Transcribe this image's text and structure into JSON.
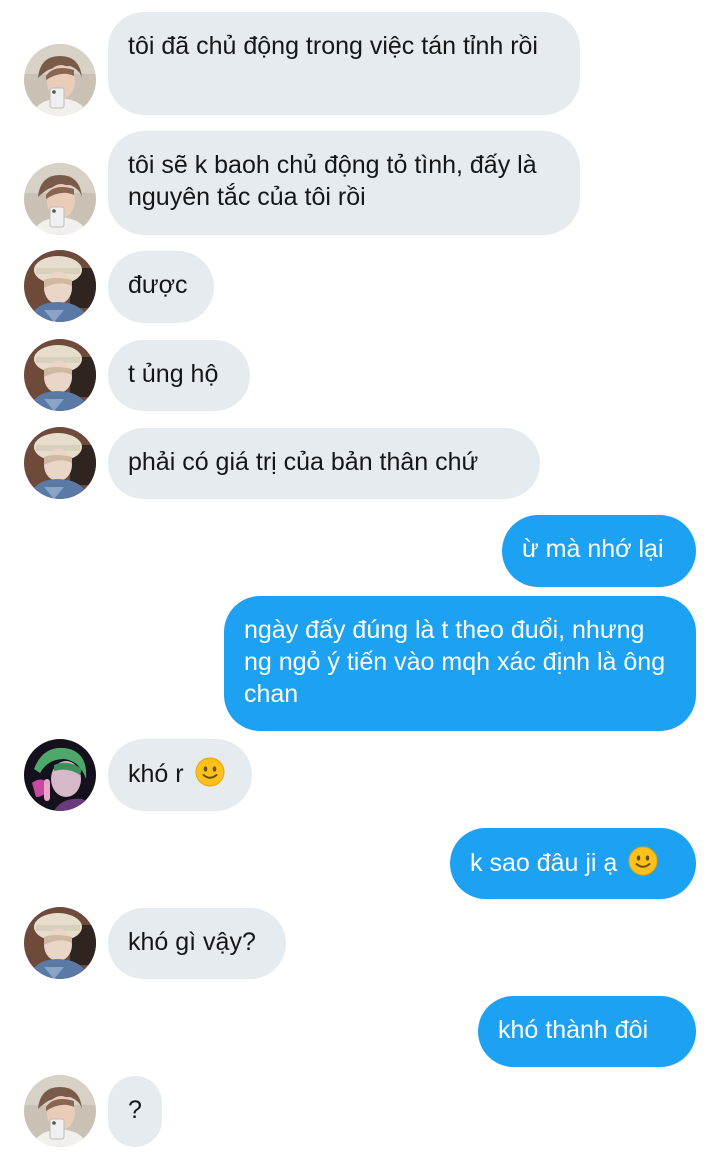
{
  "conversation": {
    "messages": [
      {
        "sender": "user-a",
        "text": "tôi đã chủ động trong việc tán tỉnh rồi",
        "avatar": "selfie-avatar-a"
      },
      {
        "sender": "user-a",
        "text": "tôi sẽ k baoh chủ động tỏ tình, đấy là nguyên tắc của tôi rồi",
        "avatar": "selfie-avatar-a"
      },
      {
        "sender": "user-b",
        "text": "được",
        "avatar": "hat-avatar-b"
      },
      {
        "sender": "user-b",
        "text": "t ủng hộ",
        "avatar": "hat-avatar-b"
      },
      {
        "sender": "user-b",
        "text": "phải có giá trị của bản thân chứ",
        "avatar": "hat-avatar-b"
      },
      {
        "sender": "me",
        "text": "ừ mà nhớ lại"
      },
      {
        "sender": "me",
        "text": "ngày đấy đúng là t theo đuổi, nhưng ng ngỏ ý tiến vào mqh xác định là ông chan"
      },
      {
        "sender": "user-c",
        "text": "khó r",
        "emoji": "slightly-smiling-face-icon",
        "avatar": "green-hair-avatar-c"
      },
      {
        "sender": "me",
        "text": "k sao đâu ji ạ",
        "emoji": "slightly-smiling-face-icon"
      },
      {
        "sender": "user-b",
        "text": "khó gì vậy?",
        "avatar": "hat-avatar-b"
      },
      {
        "sender": "me",
        "text": "khó thành đôi"
      },
      {
        "sender": "user-a",
        "text": "?",
        "avatar": "selfie-avatar-a"
      }
    ]
  },
  "colors": {
    "incoming_bubble": "#e6ebef",
    "outgoing_bubble": "#1da1f2",
    "incoming_text": "#14171a",
    "outgoing_text": "#ffffff"
  }
}
